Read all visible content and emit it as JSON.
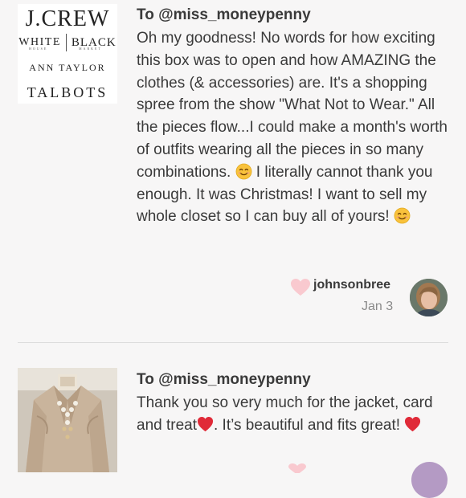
{
  "cards": [
    {
      "recipient": "To @miss_moneypenny",
      "image": {
        "logos": {
          "jcrew": "J.CREW",
          "whbm_white": "WHITE",
          "whbm_black": "BLACK",
          "whbm_sub_left": "HOUSE",
          "whbm_sub_right": "MARKET",
          "ann_taylor": "ANN TAYLOR",
          "talbots": "TALBOTS"
        }
      },
      "message": {
        "part1": "Oh my goodness! No words for how exciting this box was to open and how AMAZING the clothes (& accessories) are. It's a shopping spree from the show \"What Not to Wear.\" All the pieces flow...I could make a month's worth of outfits wearing all the pieces in so many combinations. ",
        "emoji1": "smiling-face-emoji",
        "part2": " I literally cannot thank you enough. It was Christmas! I want to sell my whole closet so I can buy all of yours! ",
        "emoji2": "smiling-face-emoji"
      },
      "author": "johnsonbree",
      "date": "Jan 3",
      "like_icon": "heart-icon",
      "like_color": "#f9c9cf"
    },
    {
      "recipient": "To @miss_moneypenny",
      "image": {
        "label": "jacket-photo"
      },
      "message": {
        "part1": "Thank you so very much for the jacket, card and treat",
        "emoji1": "red-heart-emoji",
        "part2": ". It’s beautiful and fits great! ",
        "emoji2": "red-heart-emoji"
      }
    }
  ],
  "colors": {
    "background": "#f7f6f6",
    "text": "#3a3a3a",
    "muted": "#8a8a8a",
    "heart_red": "#e02a38",
    "emoji_yellow": "#f9c23c"
  }
}
